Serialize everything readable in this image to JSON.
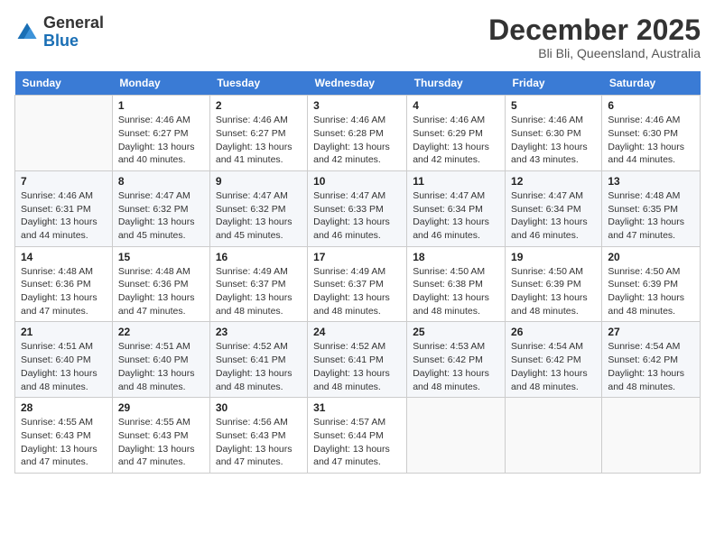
{
  "header": {
    "logo": {
      "line1": "General",
      "line2": "Blue"
    },
    "month": "December 2025",
    "location": "Bli Bli, Queensland, Australia"
  },
  "days_of_week": [
    "Sunday",
    "Monday",
    "Tuesday",
    "Wednesday",
    "Thursday",
    "Friday",
    "Saturday"
  ],
  "weeks": [
    [
      {
        "day": "",
        "info": ""
      },
      {
        "day": "1",
        "info": "Sunrise: 4:46 AM\nSunset: 6:27 PM\nDaylight: 13 hours\nand 40 minutes."
      },
      {
        "day": "2",
        "info": "Sunrise: 4:46 AM\nSunset: 6:27 PM\nDaylight: 13 hours\nand 41 minutes."
      },
      {
        "day": "3",
        "info": "Sunrise: 4:46 AM\nSunset: 6:28 PM\nDaylight: 13 hours\nand 42 minutes."
      },
      {
        "day": "4",
        "info": "Sunrise: 4:46 AM\nSunset: 6:29 PM\nDaylight: 13 hours\nand 42 minutes."
      },
      {
        "day": "5",
        "info": "Sunrise: 4:46 AM\nSunset: 6:30 PM\nDaylight: 13 hours\nand 43 minutes."
      },
      {
        "day": "6",
        "info": "Sunrise: 4:46 AM\nSunset: 6:30 PM\nDaylight: 13 hours\nand 44 minutes."
      }
    ],
    [
      {
        "day": "7",
        "info": "Sunrise: 4:46 AM\nSunset: 6:31 PM\nDaylight: 13 hours\nand 44 minutes."
      },
      {
        "day": "8",
        "info": "Sunrise: 4:47 AM\nSunset: 6:32 PM\nDaylight: 13 hours\nand 45 minutes."
      },
      {
        "day": "9",
        "info": "Sunrise: 4:47 AM\nSunset: 6:32 PM\nDaylight: 13 hours\nand 45 minutes."
      },
      {
        "day": "10",
        "info": "Sunrise: 4:47 AM\nSunset: 6:33 PM\nDaylight: 13 hours\nand 46 minutes."
      },
      {
        "day": "11",
        "info": "Sunrise: 4:47 AM\nSunset: 6:34 PM\nDaylight: 13 hours\nand 46 minutes."
      },
      {
        "day": "12",
        "info": "Sunrise: 4:47 AM\nSunset: 6:34 PM\nDaylight: 13 hours\nand 46 minutes."
      },
      {
        "day": "13",
        "info": "Sunrise: 4:48 AM\nSunset: 6:35 PM\nDaylight: 13 hours\nand 47 minutes."
      }
    ],
    [
      {
        "day": "14",
        "info": "Sunrise: 4:48 AM\nSunset: 6:36 PM\nDaylight: 13 hours\nand 47 minutes."
      },
      {
        "day": "15",
        "info": "Sunrise: 4:48 AM\nSunset: 6:36 PM\nDaylight: 13 hours\nand 47 minutes."
      },
      {
        "day": "16",
        "info": "Sunrise: 4:49 AM\nSunset: 6:37 PM\nDaylight: 13 hours\nand 48 minutes."
      },
      {
        "day": "17",
        "info": "Sunrise: 4:49 AM\nSunset: 6:37 PM\nDaylight: 13 hours\nand 48 minutes."
      },
      {
        "day": "18",
        "info": "Sunrise: 4:50 AM\nSunset: 6:38 PM\nDaylight: 13 hours\nand 48 minutes."
      },
      {
        "day": "19",
        "info": "Sunrise: 4:50 AM\nSunset: 6:39 PM\nDaylight: 13 hours\nand 48 minutes."
      },
      {
        "day": "20",
        "info": "Sunrise: 4:50 AM\nSunset: 6:39 PM\nDaylight: 13 hours\nand 48 minutes."
      }
    ],
    [
      {
        "day": "21",
        "info": "Sunrise: 4:51 AM\nSunset: 6:40 PM\nDaylight: 13 hours\nand 48 minutes."
      },
      {
        "day": "22",
        "info": "Sunrise: 4:51 AM\nSunset: 6:40 PM\nDaylight: 13 hours\nand 48 minutes."
      },
      {
        "day": "23",
        "info": "Sunrise: 4:52 AM\nSunset: 6:41 PM\nDaylight: 13 hours\nand 48 minutes."
      },
      {
        "day": "24",
        "info": "Sunrise: 4:52 AM\nSunset: 6:41 PM\nDaylight: 13 hours\nand 48 minutes."
      },
      {
        "day": "25",
        "info": "Sunrise: 4:53 AM\nSunset: 6:42 PM\nDaylight: 13 hours\nand 48 minutes."
      },
      {
        "day": "26",
        "info": "Sunrise: 4:54 AM\nSunset: 6:42 PM\nDaylight: 13 hours\nand 48 minutes."
      },
      {
        "day": "27",
        "info": "Sunrise: 4:54 AM\nSunset: 6:42 PM\nDaylight: 13 hours\nand 48 minutes."
      }
    ],
    [
      {
        "day": "28",
        "info": "Sunrise: 4:55 AM\nSunset: 6:43 PM\nDaylight: 13 hours\nand 47 minutes."
      },
      {
        "day": "29",
        "info": "Sunrise: 4:55 AM\nSunset: 6:43 PM\nDaylight: 13 hours\nand 47 minutes."
      },
      {
        "day": "30",
        "info": "Sunrise: 4:56 AM\nSunset: 6:43 PM\nDaylight: 13 hours\nand 47 minutes."
      },
      {
        "day": "31",
        "info": "Sunrise: 4:57 AM\nSunset: 6:44 PM\nDaylight: 13 hours\nand 47 minutes."
      },
      {
        "day": "",
        "info": ""
      },
      {
        "day": "",
        "info": ""
      },
      {
        "day": "",
        "info": ""
      }
    ]
  ]
}
